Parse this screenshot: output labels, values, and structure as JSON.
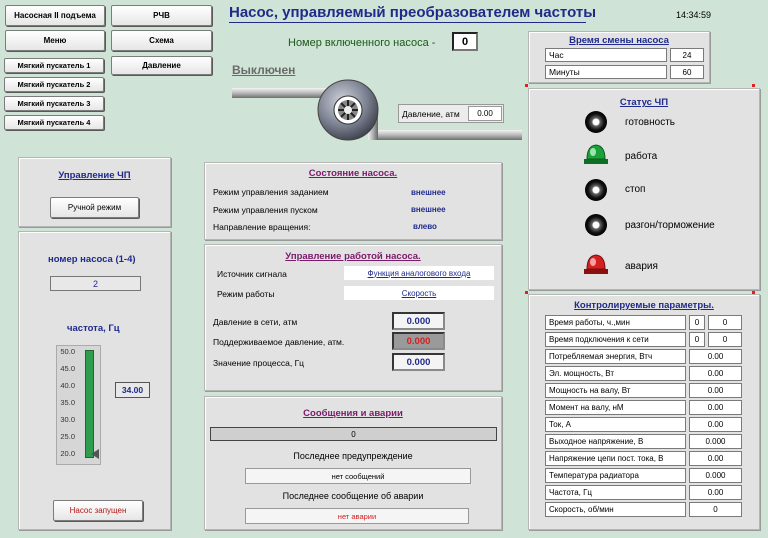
{
  "nav": {
    "pump_station": "Насосная II подъема",
    "rchv": "РЧВ",
    "menu": "Меню",
    "scheme": "Схема",
    "soft_starters": [
      "Мягкий пускатель 1",
      "Мягкий пускатель 2",
      "Мягкий пускатель 3",
      "Мягкий пускатель 4"
    ],
    "pressure": "Давление"
  },
  "header": {
    "title": "Насос, управляемый преобразователем частоты",
    "clock": "14:34:59"
  },
  "pump": {
    "active_label": "Номер включенного насоса -",
    "active_value": "0",
    "state": "Выключен",
    "pressure_label": "Давление, атм",
    "pressure_value": "0.00"
  },
  "shift": {
    "title": "Время смены насоса",
    "hour_label": "Час",
    "hour_value": "24",
    "min_label": "Минуты",
    "min_value": "60"
  },
  "vfd_status": {
    "title": "Статус ЧП",
    "items": [
      {
        "label": "готовность"
      },
      {
        "label": "работа"
      },
      {
        "label": "стоп"
      },
      {
        "label": "разгон/торможение"
      },
      {
        "label": "авария"
      }
    ]
  },
  "vfd_control": {
    "title": "Управление ЧП",
    "manual_btn": "Ручной режим"
  },
  "pump_select": {
    "title": "номер насоса (1-4)",
    "value": "2",
    "freq_title": "частота, Гц",
    "freq_value": "34.00",
    "scale": [
      "50.0",
      "45.0",
      "40.0",
      "35.0",
      "30.0",
      "25.0",
      "20.0"
    ],
    "start_btn": "Насос запущен"
  },
  "pump_state": {
    "title": "Состояние насоса.",
    "rows": [
      {
        "label": "Режим управления заданием",
        "value": "внешнее"
      },
      {
        "label": "Режим управления пуском",
        "value": "внешнее"
      },
      {
        "label": "Направление вращения:",
        "value": "влево"
      }
    ]
  },
  "pump_control": {
    "title": "Управление работой насоса.",
    "source_label": "Источник сигнала",
    "source_value": "Функция аналогового входа",
    "mode_label": "Режим работы",
    "mode_value": "Скорость",
    "net_pressure_label": "Давление в сети, атм",
    "net_pressure_value": "0.000",
    "setpoint_label": "Поддерживаемое давление, атм.",
    "setpoint_value": "0.000",
    "process_label": "Значение процесса, Гц",
    "process_value": "0.000"
  },
  "messages": {
    "title": "Сообщения и аварии",
    "counter": "0",
    "last_warning_label": "Последнее предупреждение",
    "last_warning_value": "нет сообщений",
    "last_alarm_label": "Последнее сообщение об аварии",
    "last_alarm_value": "нет аварии"
  },
  "params": {
    "title": "Контролируемые параметры.",
    "rows": [
      {
        "label": "Время работы, ч.,мин",
        "v1": "0",
        "v2": "0"
      },
      {
        "label": "Время подключения к сети",
        "v1": "0",
        "v2": "0"
      },
      {
        "label": "Потребляемая энергия, Втч",
        "v": "0.00"
      },
      {
        "label": " Эл. мощность, Вт",
        "v": "0.00"
      },
      {
        "label": "Мощность на валу, Вт",
        "v": "0.00"
      },
      {
        "label": "Момент на валу, нМ",
        "v": "0.00"
      },
      {
        "label": "Ток, А",
        "v": "0.00"
      },
      {
        "label": "Выходное напряжение, В",
        "v": "0.000"
      },
      {
        "label": "Напряжение цепи пост. тока, В",
        "v": "0.00"
      },
      {
        "label": "Температура радиатора",
        "v": "0.000"
      },
      {
        "label": "Частота, Гц",
        "v": "0.00"
      },
      {
        "label": "Скорость, об/мин",
        "v": "0"
      }
    ]
  },
  "colors": {
    "title": "#1f2a8c",
    "alarm_red": "#d42020",
    "run_green": "#1aa23a",
    "slider_green": "#2e9e4e"
  }
}
